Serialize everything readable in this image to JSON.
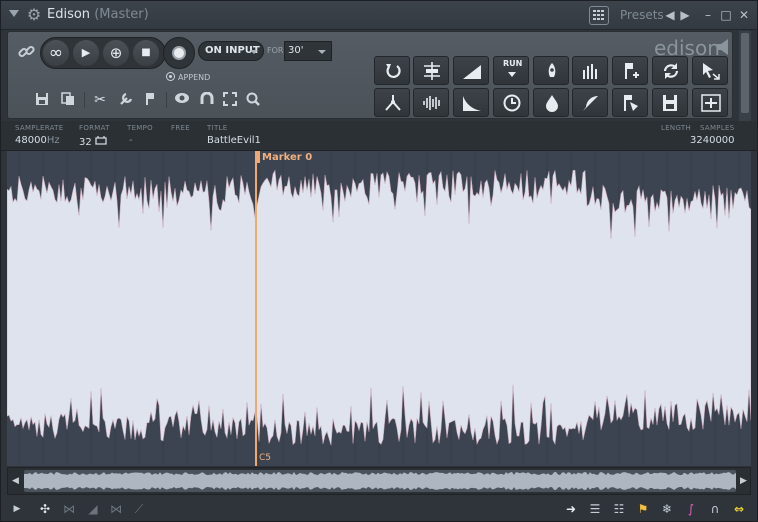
{
  "window": {
    "title": "Edison",
    "subtitle": "(Master)"
  },
  "titlebar": {
    "presets_label": "Presets",
    "prev": "◀",
    "next": "▶",
    "minimize": "–",
    "maximize": "□",
    "close": "✕"
  },
  "transport": {
    "loop": "∞",
    "play": "▶",
    "record_mode": "⊕",
    "stop": "■"
  },
  "record": {
    "mode": "ON INPUT",
    "for_label": "FOR",
    "for_value": "30'",
    "append_label": "APPEND"
  },
  "logo": "edison",
  "info": {
    "samplerate_label": "SAMPLERATE",
    "samplerate_value": "48000",
    "samplerate_unit": "Hz",
    "format_label": "FORMAT",
    "format_value": "32",
    "tempo_label": "TEMPO",
    "tempo_value": "-",
    "free_label": "FREE",
    "title_label": "TITLE",
    "title_value": "BattleEvil1",
    "length_label": "LENGTH",
    "samples_label": "SAMPLES",
    "samples_value": "3240000"
  },
  "marker": {
    "label": "Marker 0",
    "note": "C5"
  },
  "colors": {
    "waveform": "#dfe3ee",
    "background": "#3b4450",
    "marker": "#f0a870",
    "accent": "#f0c040"
  },
  "function_buttons": {
    "row1": [
      "RUN"
    ]
  }
}
